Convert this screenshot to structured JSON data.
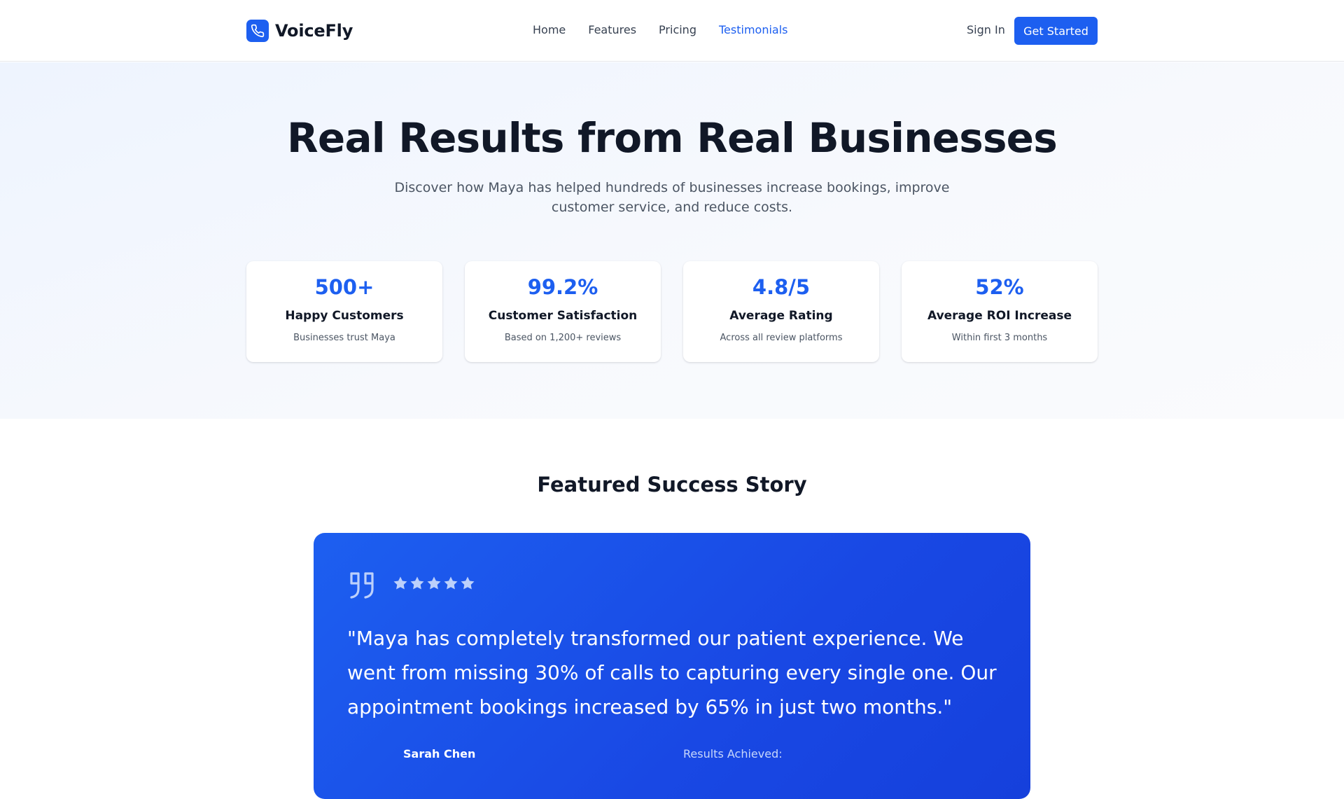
{
  "brand": {
    "name": "VoiceFly",
    "accent": "#1d5ff0"
  },
  "nav": {
    "items": [
      {
        "label": "Home"
      },
      {
        "label": "Features"
      },
      {
        "label": "Pricing"
      },
      {
        "label": "Testimonials"
      }
    ],
    "active": "Testimonials",
    "sign_in": "Sign In",
    "cta": "Get Started"
  },
  "hero": {
    "title": "Real Results from Real Businesses",
    "subtitle": "Discover how Maya has helped hundreds of businesses increase bookings, improve customer service, and reduce costs."
  },
  "stats": [
    {
      "value": "500+",
      "label": "Happy Customers",
      "description": "Businesses trust Maya"
    },
    {
      "value": "99.2%",
      "label": "Customer Satisfaction",
      "description": "Based on 1,200+ reviews"
    },
    {
      "value": "4.8/5",
      "label": "Average Rating",
      "description": "Across all review platforms"
    },
    {
      "value": "52%",
      "label": "Average ROI Increase",
      "description": "Within first 3 months"
    }
  ],
  "featured": {
    "title": "Featured Success Story",
    "rating": 5,
    "quote": "\"Maya has completely transformed our patient experience. We went from missing 30% of calls to capturing every single one. Our appointment bookings increased by 65% in just two months.\"",
    "author_name": "Sarah Chen",
    "results_label": "Results Achieved:"
  },
  "colors": {
    "primary": "#1d5ff0",
    "text_dark": "#111827",
    "text_muted": "#4b5563",
    "card_gradient_end": "#1540dc"
  }
}
